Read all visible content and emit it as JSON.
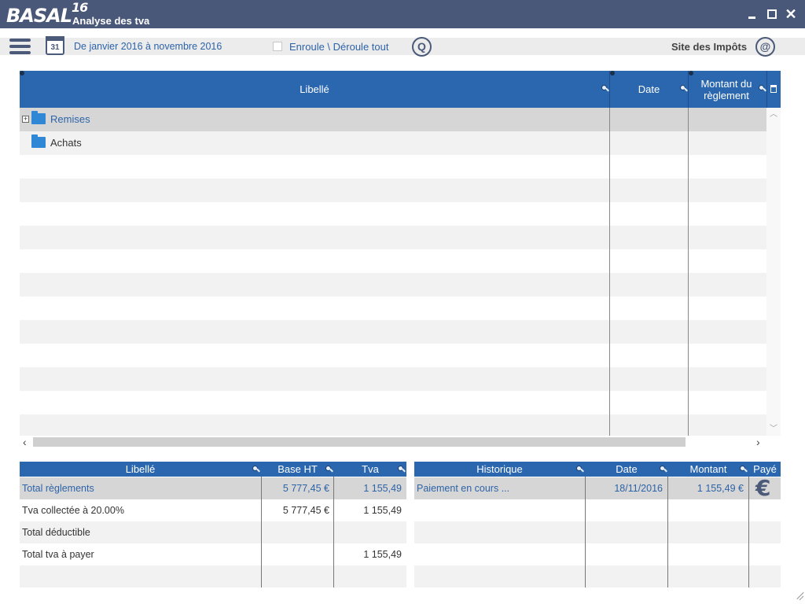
{
  "app": {
    "logo": "BASAL",
    "logo_version": "16",
    "window_title": "Analyse des tva",
    "accent": "#2b67af",
    "titlebar_color": "#495878"
  },
  "toolbar": {
    "period": "De janvier 2016 à novembre 2016",
    "calendar_day": "31",
    "expand_label": "Enroule \\ Déroule tout",
    "tax_site_label": "Site des Impôts"
  },
  "main_grid": {
    "columns": [
      "Libellé",
      "Date",
      "Montant du\nrèglement"
    ],
    "rows": [
      {
        "label": "Remises",
        "date": "",
        "amount": ""
      },
      {
        "label": "Achats",
        "date": "",
        "amount": ""
      }
    ]
  },
  "summary_table": {
    "columns": [
      "Libellé",
      "Base HT",
      "Tva"
    ],
    "rows": [
      {
        "label": "Total règlements",
        "base": "5 777,45 €",
        "tva": "1 155,49"
      },
      {
        "label": "Tva collectée à 20.00%",
        "base": "5 777,45 €",
        "tva": "1 155,49"
      },
      {
        "label": "Total déductible",
        "base": "",
        "tva": ""
      },
      {
        "label": "Total tva à payer",
        "base": "",
        "tva": "1 155,49"
      }
    ]
  },
  "history_table": {
    "columns": [
      "Historique",
      "Date",
      "Montant",
      "Payé"
    ],
    "rows": [
      {
        "label": "Paiement en cours ...",
        "date": "18/11/2016",
        "amount": "1 155,49 €"
      }
    ]
  }
}
